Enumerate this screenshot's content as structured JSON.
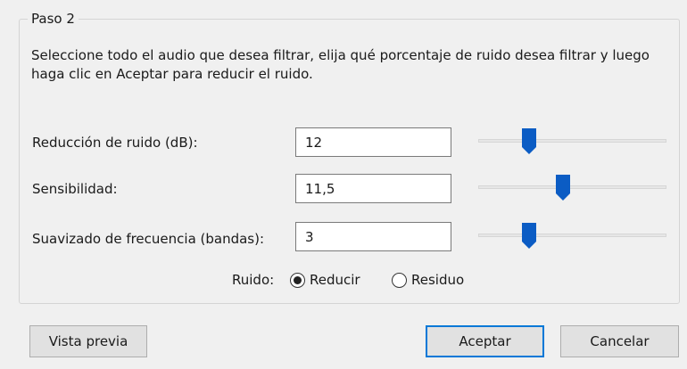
{
  "group": {
    "legend": "Paso 2"
  },
  "instructions": "Seleccione todo el audio que desea filtrar, elija qué porcentaje de ruido desea filtrar y luego haga clic en Aceptar para reducir el ruido.",
  "rows": [
    {
      "label": "Reducción de ruido (dB):",
      "value": "12",
      "slider_fraction": 0.27
    },
    {
      "label": "Sensibilidad:",
      "value": "11,5",
      "slider_fraction": 0.45
    },
    {
      "label": "Suavizado de frecuencia (bandas):",
      "value": "3",
      "slider_fraction": 0.27
    }
  ],
  "noise": {
    "label": "Ruido:",
    "options": [
      {
        "label": "Reducir",
        "checked": true
      },
      {
        "label": "Residuo",
        "checked": false
      }
    ]
  },
  "buttons": {
    "preview": "Vista previa",
    "accept": "Aceptar",
    "cancel": "Cancelar"
  },
  "colors": {
    "slider_thumb": "#0b5cc4",
    "default_button_border": "#0078d7"
  }
}
